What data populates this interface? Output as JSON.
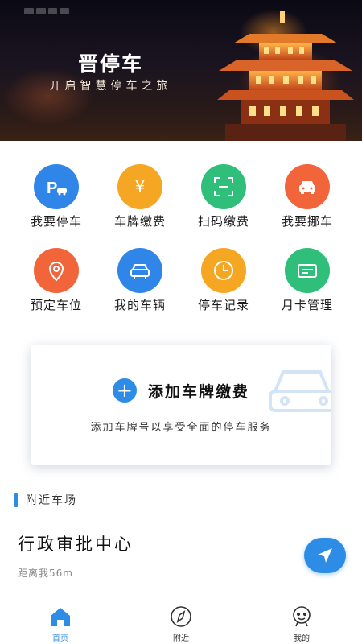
{
  "banner": {
    "title": "晋停车",
    "subtitle": "开启智慧停车之旅"
  },
  "services": [
    {
      "label": "我要停车",
      "icon": "parking-car-icon",
      "color": "#2f86e8"
    },
    {
      "label": "车牌缴费",
      "icon": "yuan-icon",
      "color": "#f5a623"
    },
    {
      "label": "扫码缴费",
      "icon": "scan-icon",
      "color": "#2fbf7a"
    },
    {
      "label": "我要挪车",
      "icon": "move-car-icon",
      "color": "#f2643a"
    },
    {
      "label": "预定车位",
      "icon": "location-pin-icon",
      "color": "#f2643a"
    },
    {
      "label": "我的车辆",
      "icon": "car-front-icon",
      "color": "#2f86e8"
    },
    {
      "label": "停车记录",
      "icon": "clock-icon",
      "color": "#f5a623"
    },
    {
      "label": "月卡管理",
      "icon": "card-icon",
      "color": "#2fbf7a"
    }
  ],
  "add_plate": {
    "plus": "+",
    "title": "添加车牌缴费",
    "description": "添加车牌号以享受全面的停车服务"
  },
  "nearby": {
    "section_title": "附近车场",
    "lot_name": "行政审批中心",
    "distance": "距离我56m"
  },
  "tabbar": {
    "items": [
      {
        "label": "首页",
        "icon": "home-icon",
        "active": true
      },
      {
        "label": "附近",
        "icon": "compass-icon",
        "active": false
      },
      {
        "label": "我的",
        "icon": "profile-icon",
        "active": false
      }
    ]
  },
  "colors": {
    "accent": "#2d8ce6"
  }
}
